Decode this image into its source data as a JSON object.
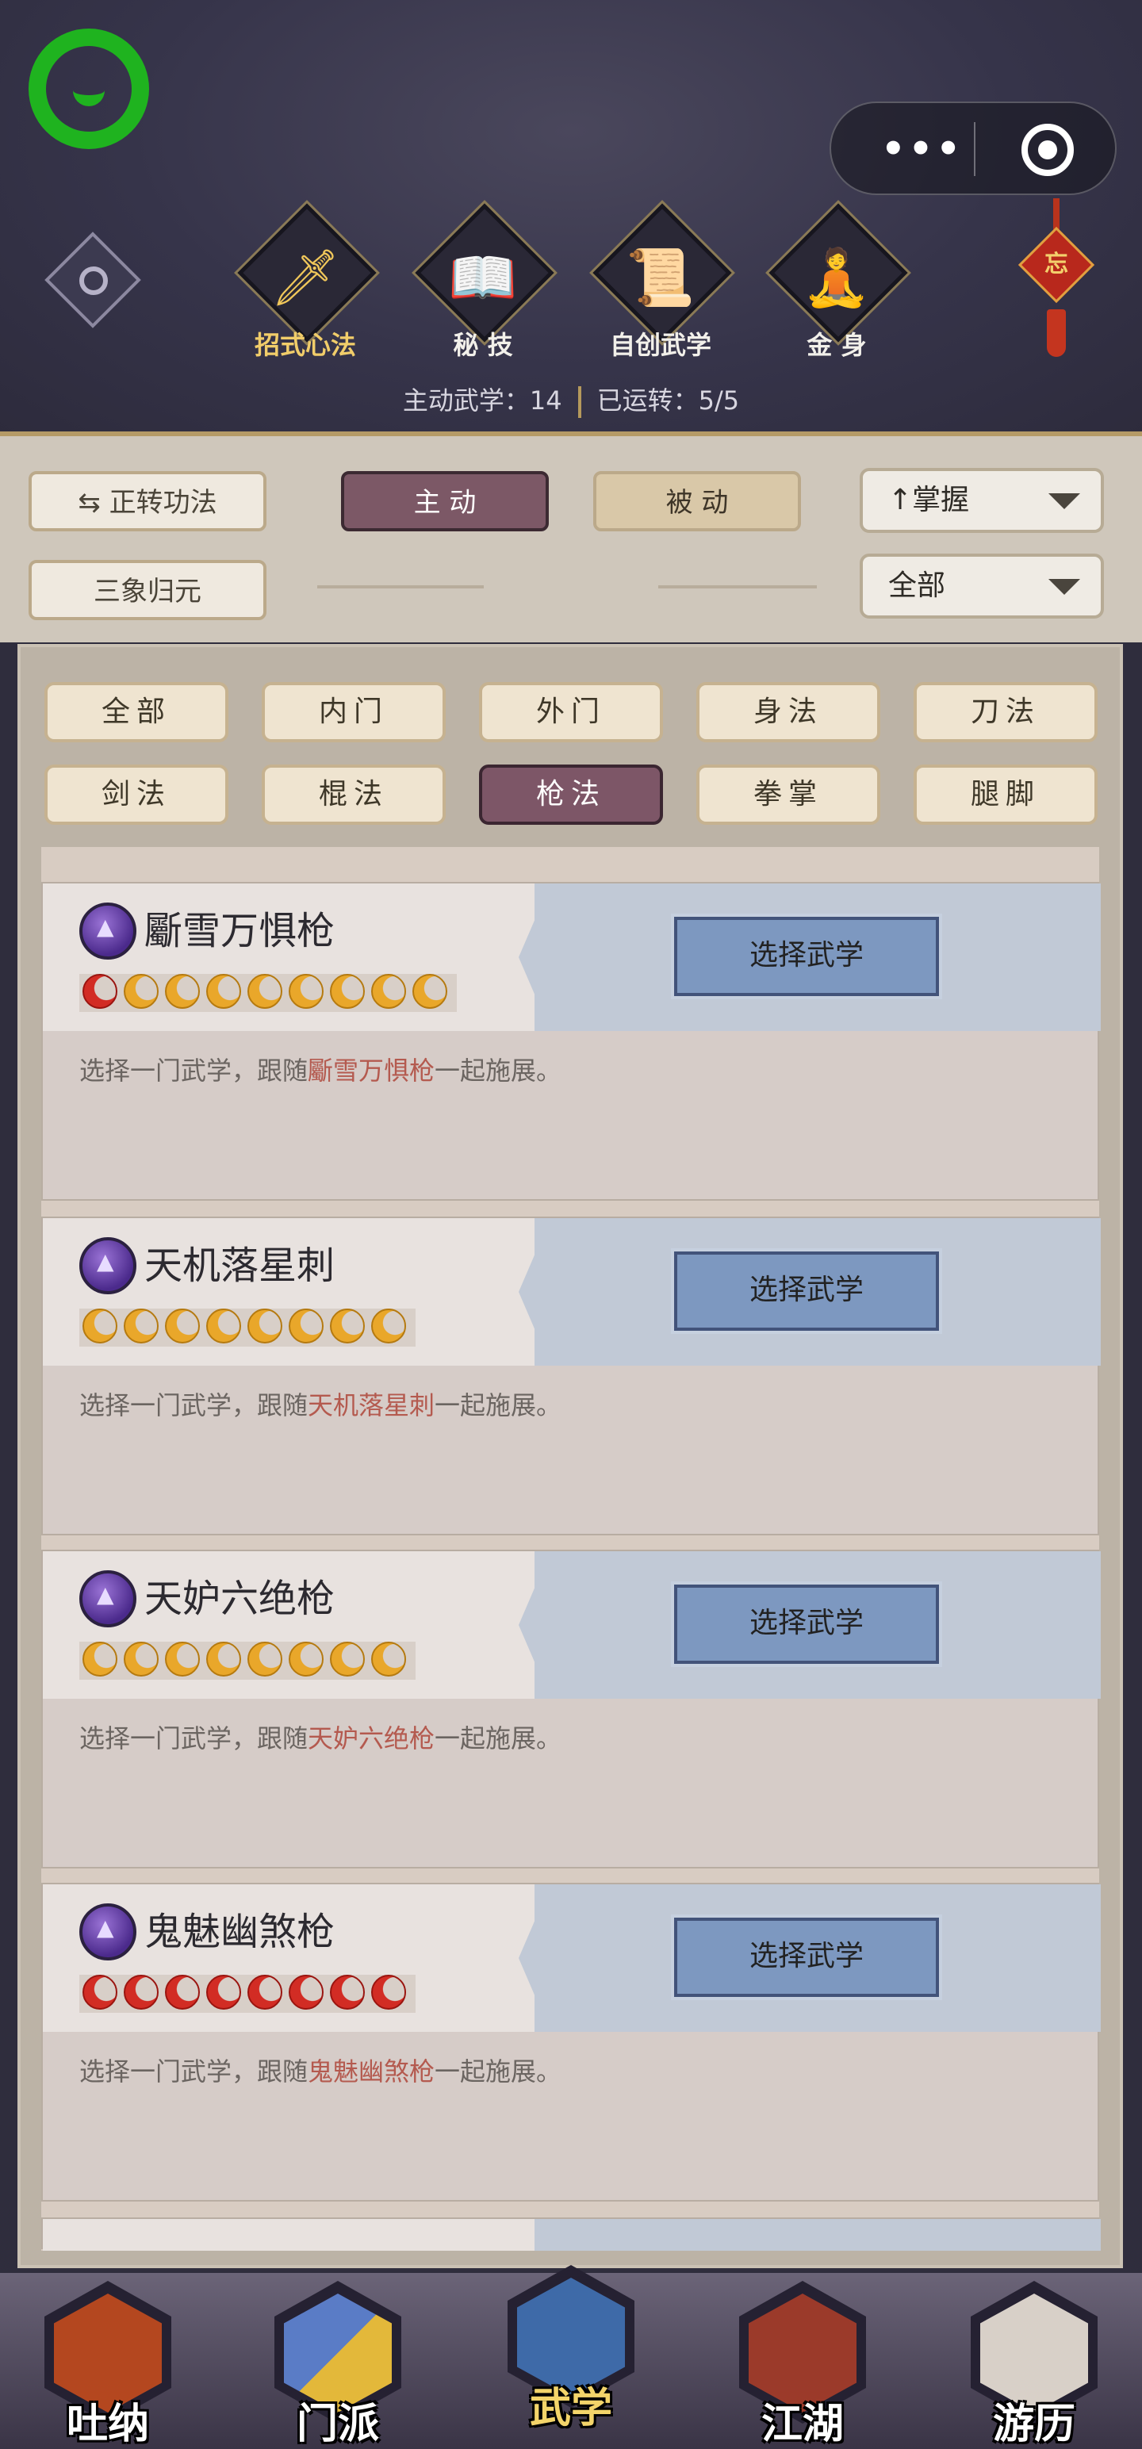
{
  "header": {
    "category_tabs": [
      {
        "label": "招式心法",
        "icon": "sword-icon",
        "active": true
      },
      {
        "label": "秘 技",
        "icon": "book-icon",
        "active": false
      },
      {
        "label": "自创武学",
        "icon": "scroll-icon",
        "active": false
      },
      {
        "label": "金 身",
        "icon": "meditation-icon",
        "active": false
      }
    ],
    "knot_char": "忘",
    "stats": {
      "active_label": "主动武学：",
      "active_value": "14",
      "running_label": "已运转：",
      "running_value": "5/5"
    }
  },
  "capsule": {
    "more": "•••"
  },
  "filters": {
    "convert_button": "正转功法",
    "active_button": "主 动",
    "passive_button": "被 动",
    "sanxiang_button": "三象归元",
    "sort_dropdown": "掌握",
    "scope_dropdown": "全部"
  },
  "type_tabs": [
    {
      "label": "全部",
      "active": false
    },
    {
      "label": "内门",
      "active": false
    },
    {
      "label": "外门",
      "active": false
    },
    {
      "label": "身法",
      "active": false
    },
    {
      "label": "刀法",
      "active": false
    },
    {
      "label": "剑法",
      "active": false
    },
    {
      "label": "棍法",
      "active": false
    },
    {
      "label": "枪法",
      "active": true
    },
    {
      "label": "拳掌",
      "active": false
    },
    {
      "label": "腿脚",
      "active": false
    }
  ],
  "skills": [
    {
      "name": "斸雪万惧枪",
      "stars": [
        "red",
        "gold",
        "gold",
        "gold",
        "gold",
        "gold",
        "gold",
        "gold",
        "gold"
      ],
      "button": "选择武学",
      "desc_before": "选择一门武学，跟随",
      "desc_highlight": "斸雪万惧枪",
      "desc_after": "一起施展。"
    },
    {
      "name": "天机落星刺",
      "stars": [
        "gold",
        "gold",
        "gold",
        "gold",
        "gold",
        "gold",
        "gold",
        "gold"
      ],
      "button": "选择武学",
      "desc_before": "选择一门武学，跟随",
      "desc_highlight": "天机落星刺",
      "desc_after": "一起施展。"
    },
    {
      "name": "天妒六绝枪",
      "stars": [
        "gold",
        "gold",
        "gold",
        "gold",
        "gold",
        "gold",
        "gold",
        "gold"
      ],
      "button": "选择武学",
      "desc_before": "选择一门武学，跟随",
      "desc_highlight": "天妒六绝枪",
      "desc_after": "一起施展。"
    },
    {
      "name": "鬼魅幽煞枪",
      "stars": [
        "red",
        "red",
        "red",
        "red",
        "red",
        "red",
        "red",
        "red"
      ],
      "button": "选择武学",
      "desc_before": "选择一门武学，跟随",
      "desc_highlight": "鬼魅幽煞枪",
      "desc_after": "一起施展。"
    }
  ],
  "bottom_nav": [
    {
      "label": "吐纳",
      "active": false,
      "color": "#b4471f"
    },
    {
      "label": "门派",
      "active": false,
      "color": "#5a7cc6"
    },
    {
      "label": "武学",
      "active": true,
      "color": "#3e6aa8"
    },
    {
      "label": "江湖",
      "active": false,
      "color": "#9b3a2a"
    },
    {
      "label": "游历",
      "active": false,
      "color": "#d8d0c8"
    }
  ]
}
